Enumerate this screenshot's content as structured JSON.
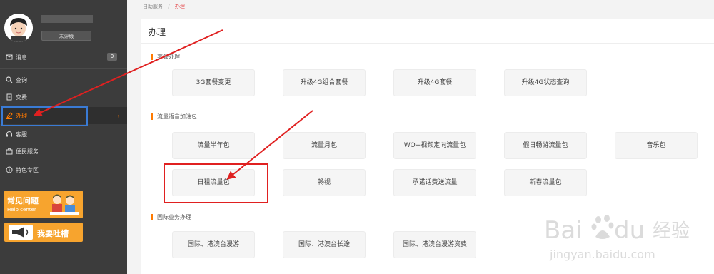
{
  "sidebar": {
    "rating_label": "未评级",
    "items": [
      {
        "label": "消息",
        "badge": "0",
        "icon": "message-icon"
      },
      {
        "label": "查询",
        "icon": "search-icon"
      },
      {
        "label": "交费",
        "icon": "document-icon"
      },
      {
        "label": "办理",
        "icon": "pen-icon",
        "active": true
      },
      {
        "label": "客服",
        "icon": "headset-icon"
      },
      {
        "label": "便民服务",
        "icon": "briefcase-icon"
      },
      {
        "label": "特色专区",
        "icon": "info-icon"
      }
    ],
    "faq_banner": {
      "title": "常见问题",
      "subtitle": "Help center"
    },
    "complain_banner": {
      "label": "我要吐槽"
    }
  },
  "breadcrumb": {
    "parent": "自助服务",
    "current": "办理"
  },
  "panel": {
    "title": "办理",
    "sections": [
      {
        "title": "套餐办理",
        "buttons": [
          "3G套餐变更",
          "升级4G组合套餐",
          "升级4G套餐",
          "升级4G状态查询"
        ]
      },
      {
        "title": "流量语音加油包",
        "buttons": [
          "流量半年包",
          "流量月包",
          "WO+视频定向流量包",
          "假日畅游流量包",
          "音乐包",
          "日租流量包",
          "畅视",
          "承诺话费送流量",
          "新春流量包"
        ]
      },
      {
        "title": "国际业务办理",
        "buttons": [
          "国际、港澳台漫游",
          "国际、港澳台长途",
          "国际、港澳台漫游资费"
        ]
      }
    ]
  },
  "colors": {
    "accent": "#ff7a00",
    "sidebar_bg": "#3c3c3c",
    "annotation_red": "#e02020",
    "annotation_blue": "#3a7bd5"
  },
  "watermark": {
    "brand": "Bai",
    "brand2": "du",
    "cn": "经验",
    "url": "jingyan.baidu.com"
  }
}
